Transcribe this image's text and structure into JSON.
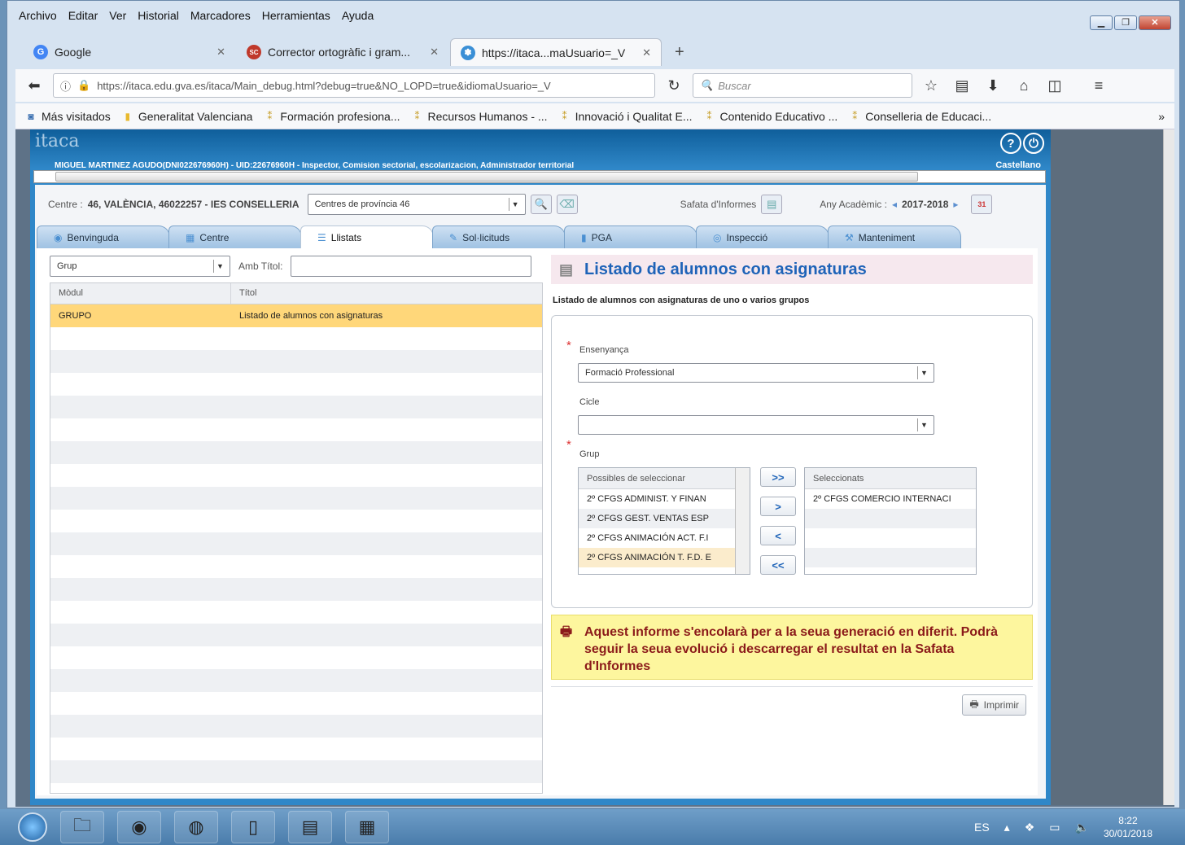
{
  "menu": [
    "Archivo",
    "Editar",
    "Ver",
    "Historial",
    "Marcadores",
    "Herramientas",
    "Ayuda"
  ],
  "tabs": [
    {
      "title": "Google",
      "icon": "G",
      "color": "#4285f4"
    },
    {
      "title": "Corrector ortogràfic i gram...",
      "icon": "SC",
      "color": "#c0392b"
    },
    {
      "title": "https://itaca...maUsuario=_V",
      "icon": "✽",
      "color": "#3a8fd6"
    }
  ],
  "url": "https://itaca.edu.gva.es/itaca/Main_debug.html?debug=true&NO_LOPD=true&idiomaUsuario=_V",
  "search_placeholder": "Buscar",
  "bookmarks": [
    "Más visitados",
    "Generalitat Valenciana",
    "Formación profesiona...",
    "Recursos Humanos - ...",
    "Innovació i Qualitat E...",
    "Contenido Educativo ...",
    "Conselleria de Educaci..."
  ],
  "app": {
    "logo": "itaca",
    "user_line": "MIGUEL MARTINEZ AGUDO(DNI022676960H) - UID:22676960H - Inspector, Comision sectorial, escolarizacion, Administrador territorial",
    "language": "Castellano",
    "centre_label": "Centre :",
    "centre_value": "46, VALÈNCIA, 46022257 - IES CONSELLERIA",
    "centre_select": "Centres de província 46",
    "safata_label": "Safata d'Informes",
    "any_label": "Any Acadèmic :",
    "any_value": "2017-2018",
    "calendar_day": "31",
    "app_tabs": [
      "Benvinguda",
      "Centre",
      "Llistats",
      "Sol·licituds",
      "PGA",
      "Inspecció",
      "Manteniment"
    ]
  },
  "left": {
    "filter_select": "Grup",
    "title_filter_label": "Amb Títol:",
    "col_module": "Mòdul",
    "col_title": "Títol",
    "rows": [
      {
        "module": "GRUPO",
        "title": "Listado de alumnos con asignaturas"
      }
    ]
  },
  "right": {
    "title": "Listado de alumnos con asignaturas",
    "subtitle": "Listado de alumnos con asignaturas de uno o varios grupos",
    "ensenyanca_label": "Ensenyança",
    "ensenyanca_value": "Formació Professional",
    "cicle_label": "Cicle",
    "cicle_value": "",
    "grup_label": "Grup",
    "possibles_header": "Possibles de seleccionar",
    "possibles": [
      "2º CFGS ADMINIST. Y FINAN",
      "2º CFGS GEST. VENTAS ESP",
      "2º CFGS ANIMACIÓN ACT. F.I",
      "2º CFGS ANIMACIÓN T. F.D. E"
    ],
    "seleccionats_header": "Seleccionats",
    "seleccionats": [
      "2º CFGS COMERCIO INTERNACI"
    ],
    "buttons": [
      ">>",
      ">",
      "<",
      "<<"
    ],
    "notice": "Aquest informe s'encolarà per a la seua generació en diferit. Podrà seguir la seua evolució i descarregar el resultat en la Safata d'Informes",
    "print_label": "Imprimir"
  },
  "taskbar": {
    "lang": "ES",
    "time": "8:22",
    "date": "30/01/2018"
  }
}
